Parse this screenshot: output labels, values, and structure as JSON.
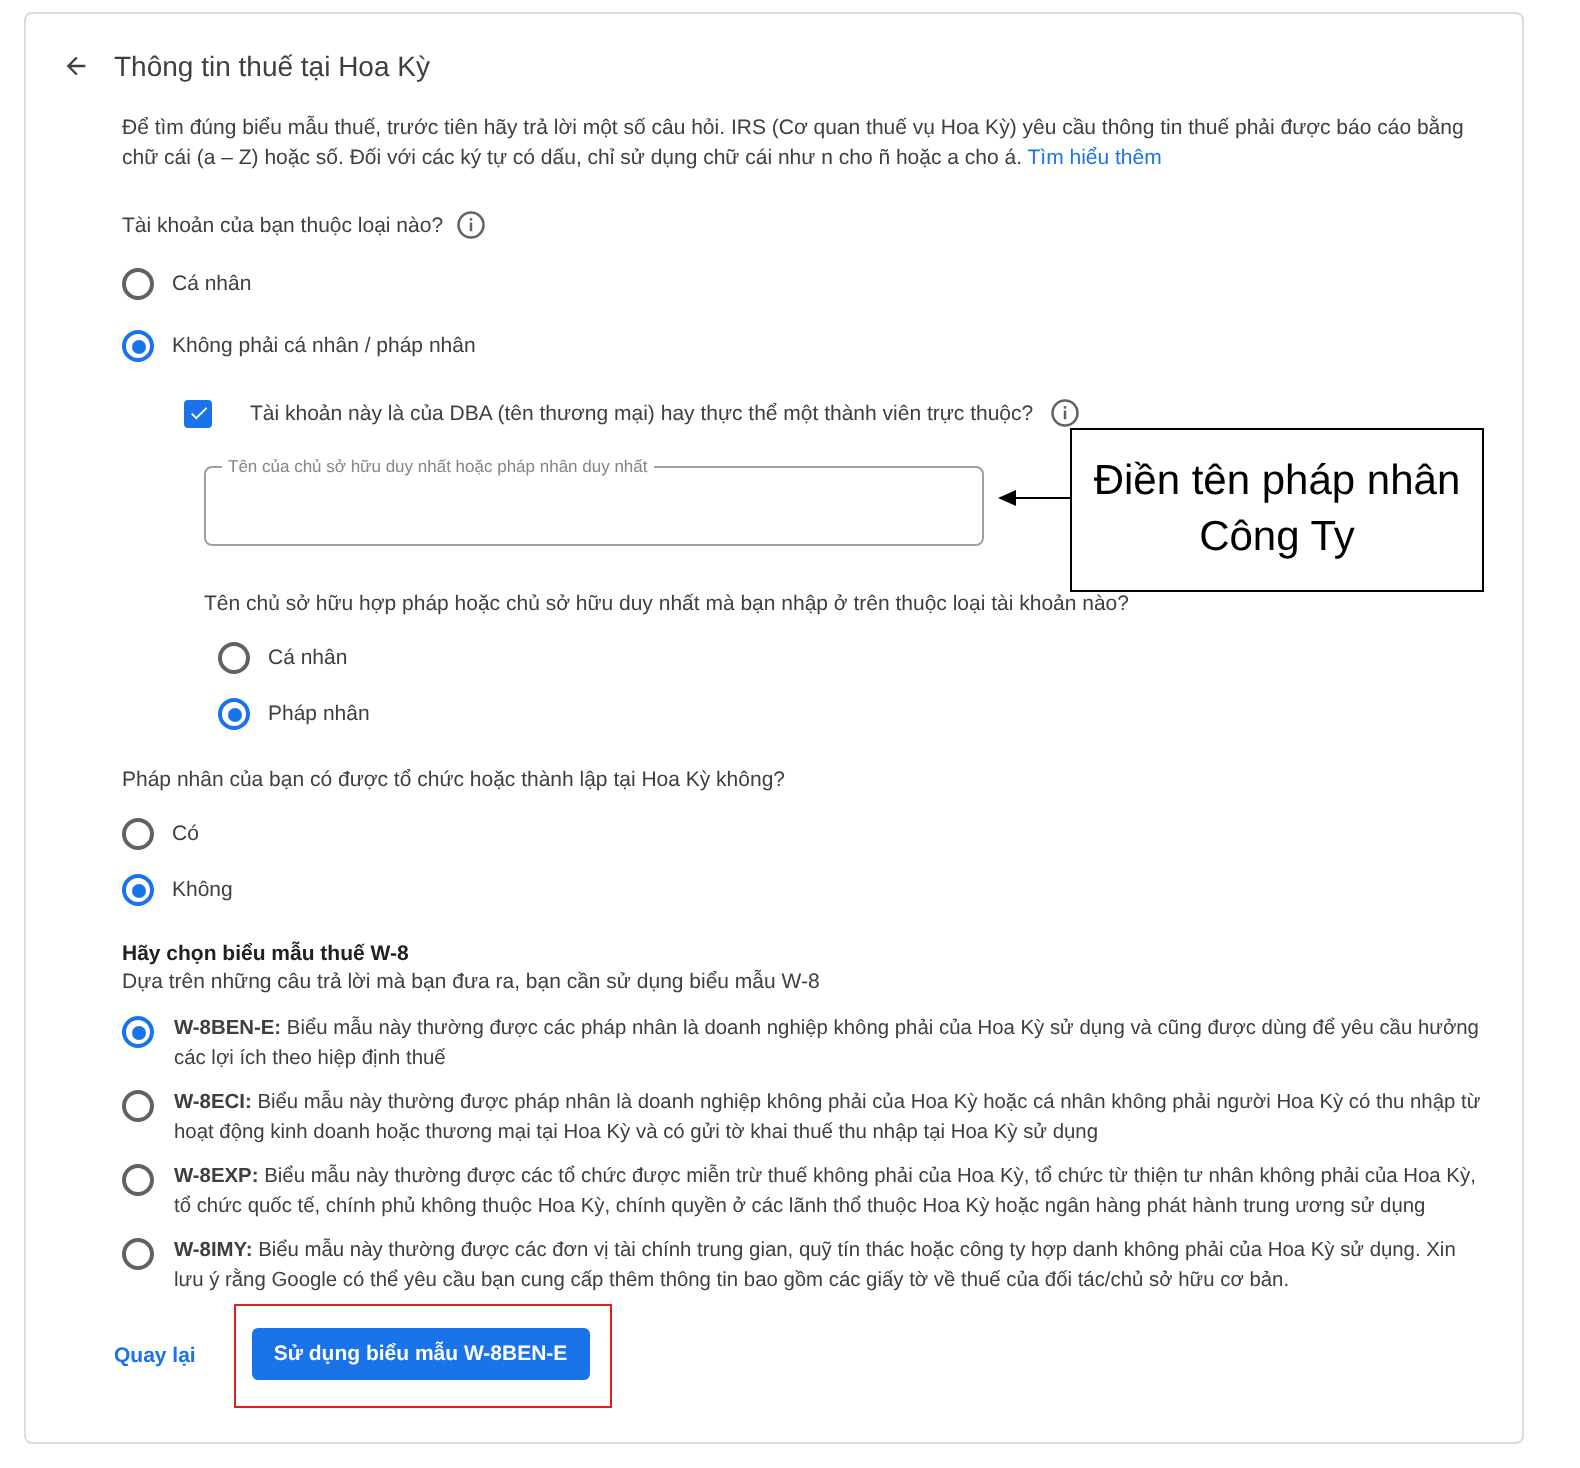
{
  "header": {
    "title": "Thông tin thuế tại Hoa Kỳ"
  },
  "intro": {
    "text": "Để tìm đúng biểu mẫu thuế, trước tiên hãy trả lời một số câu hỏi. IRS (Cơ quan thuế vụ Hoa Kỳ) yêu cầu thông tin thuế phải được báo cáo bằng chữ cái (a – Z) hoặc số. Đối với các ký tự có dấu, chỉ sử dụng chữ cái như n cho ñ hoặc a cho á.",
    "link": "Tìm hiểu thêm"
  },
  "account_type": {
    "question": "Tài khoản của bạn thuộc loại nào?",
    "options": [
      {
        "label": "Cá nhân",
        "selected": false
      },
      {
        "label": "Không phải cá nhân / pháp nhân",
        "selected": true
      }
    ]
  },
  "dba": {
    "label": "Tài khoản này là của DBA (tên thương mại) hay thực thể một thành viên trực thuộc?",
    "checked": true,
    "name_field": {
      "label": "Tên của chủ sở hữu duy nhất hoặc pháp nhân duy nhất"
    },
    "owner_question": "Tên chủ sở hữu hợp pháp hoặc chủ sở hữu duy nhất mà bạn nhập ở trên thuộc loại tài khoản nào?",
    "owner_options": [
      {
        "label": "Cá nhân",
        "selected": false
      },
      {
        "label": "Pháp nhân",
        "selected": true
      }
    ]
  },
  "us_entity": {
    "question": "Pháp nhân của bạn có được tổ chức hoặc thành lập tại Hoa Kỳ không?",
    "options": [
      {
        "label": "Có",
        "selected": false
      },
      {
        "label": "Không",
        "selected": true
      }
    ]
  },
  "w8": {
    "heading": "Hãy chọn biểu mẫu thuế W-8",
    "subheading": "Dựa trên những câu trả lời mà bạn đưa ra, bạn cần sử dụng biểu mẫu W-8",
    "options": [
      {
        "code": "W-8BEN-E:",
        "text": "Biểu mẫu này thường được các pháp nhân là doanh nghiệp không phải của Hoa Kỳ sử dụng và cũng được dùng để yêu cầu hưởng các lợi ích theo hiệp định thuế",
        "selected": true
      },
      {
        "code": "W-8ECI:",
        "text": "Biểu mẫu này thường được pháp nhân là doanh nghiệp không phải của Hoa Kỳ hoặc cá nhân không phải người Hoa Kỳ có thu nhập từ hoạt động kinh doanh hoặc thương mại tại Hoa Kỳ và có gửi tờ khai thuế thu nhập tại Hoa Kỳ sử dụng",
        "selected": false
      },
      {
        "code": "W-8EXP:",
        "text": "Biểu mẫu này thường được các tổ chức được miễn trừ thuế không phải của Hoa Kỳ, tổ chức từ thiện tư nhân không phải của Hoa Kỳ, tổ chức quốc tế, chính phủ không thuộc Hoa Kỳ, chính quyền ở các lãnh thổ thuộc Hoa Kỳ hoặc ngân hàng phát hành trung ương sử dụng",
        "selected": false
      },
      {
        "code": "W-8IMY:",
        "text": "Biểu mẫu này thường được các đơn vị tài chính trung gian, quỹ tín thác hoặc công ty hợp danh không phải của Hoa Kỳ sử dụng. Xin lưu ý rằng Google có thể yêu cầu bạn cung cấp thêm thông tin bao gồm các giấy tờ về thuế của đối tác/chủ sở hữu cơ bản.",
        "selected": false
      }
    ]
  },
  "footer": {
    "back": "Quay lại",
    "submit": "Sử dụng biểu mẫu W-8BEN-E"
  },
  "annotation": {
    "lines": [
      "Điền tên pháp nhân",
      "Công Ty"
    ]
  }
}
